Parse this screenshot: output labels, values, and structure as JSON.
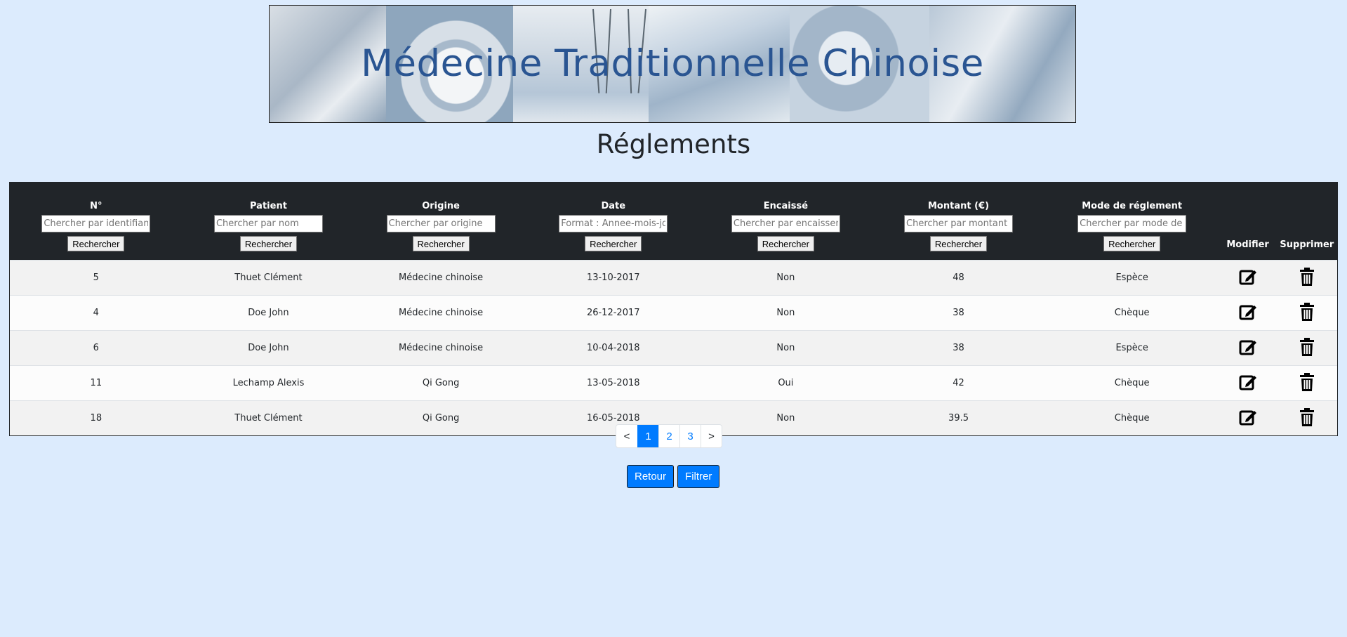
{
  "banner": {
    "title": "Médecine Traditionnelle Chinoise"
  },
  "page_title": "Réglements",
  "table": {
    "columns": [
      {
        "key": "num",
        "label": "N°",
        "placeholder": "Chercher par identifiant",
        "search_label": "Rechercher"
      },
      {
        "key": "patient",
        "label": "Patient",
        "placeholder": "Chercher par nom",
        "search_label": "Rechercher"
      },
      {
        "key": "origine",
        "label": "Origine",
        "placeholder": "Chercher par origine",
        "search_label": "Rechercher"
      },
      {
        "key": "date",
        "label": "Date",
        "placeholder": "Format : Annee-mois-jour",
        "search_label": "Rechercher"
      },
      {
        "key": "encaisse",
        "label": "Encaissé",
        "placeholder": "Chercher par encaissement",
        "search_label": "Rechercher"
      },
      {
        "key": "montant",
        "label": "Montant (€)",
        "placeholder": "Chercher par montant",
        "search_label": "Rechercher"
      },
      {
        "key": "mode",
        "label": "Mode de réglement",
        "placeholder": "Chercher par mode de réglement",
        "search_label": "Rechercher"
      }
    ],
    "modify_label": "Modifier",
    "delete_label": "Supprimer",
    "rows": [
      {
        "num": "5",
        "patient": "Thuet Clément",
        "origine": "Médecine chinoise",
        "date": "13-10-2017",
        "encaisse": "Non",
        "montant": "48",
        "mode": "Espèce"
      },
      {
        "num": "4",
        "patient": "Doe John",
        "origine": "Médecine chinoise",
        "date": "26-12-2017",
        "encaisse": "Non",
        "montant": "38",
        "mode": "Chèque"
      },
      {
        "num": "6",
        "patient": "Doe John",
        "origine": "Médecine chinoise",
        "date": "10-04-2018",
        "encaisse": "Non",
        "montant": "38",
        "mode": "Espèce"
      },
      {
        "num": "11",
        "patient": "Lechamp Alexis",
        "origine": "Qi Gong",
        "date": "13-05-2018",
        "encaisse": "Oui",
        "montant": "42",
        "mode": "Chèque"
      },
      {
        "num": "18",
        "patient": "Thuet Clément",
        "origine": "Qi Gong",
        "date": "16-05-2018",
        "encaisse": "Non",
        "montant": "39.5",
        "mode": "Chèque"
      }
    ],
    "row_icons": {
      "modify": "edit-icon",
      "delete": "trash-icon"
    }
  },
  "pagination": {
    "prev": "<",
    "pages": [
      "1",
      "2",
      "3"
    ],
    "active_page": "1",
    "next": ">"
  },
  "actions": {
    "back_label": "Retour",
    "filter_label": "Filtrer"
  },
  "colors": {
    "background": "#dcebfd",
    "header": "#212529",
    "accent": "#007bff",
    "banner_title": "#2a5592"
  }
}
